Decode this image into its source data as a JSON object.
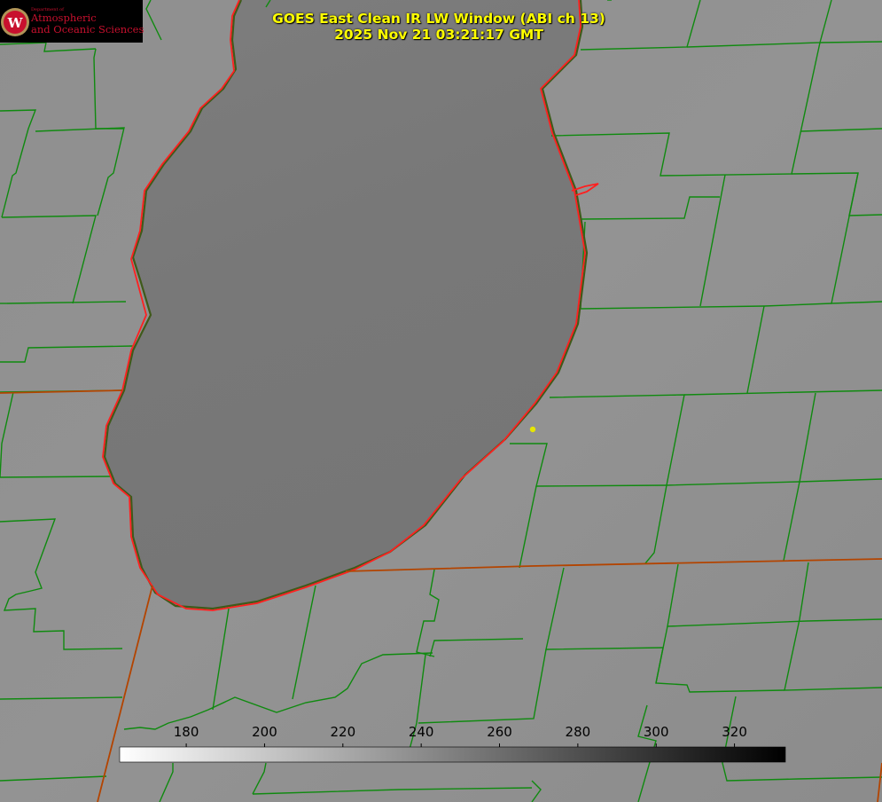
{
  "title": {
    "line1": "GOES East Clean IR LW Window (ABI ch 13)",
    "line2": "2025 Nov 21 03:21:17 GMT"
  },
  "logo": {
    "dept_small": "Department of",
    "line1": "Atmospheric",
    "line2": "and Oceanic Sciences",
    "brand_color": "#c8102e"
  },
  "colorbar": {
    "ticks": [
      "180",
      "200",
      "220",
      "240",
      "260",
      "280",
      "300",
      "320"
    ],
    "range": [
      163,
      333
    ],
    "gradient": [
      "#ffffff",
      "#000000"
    ]
  },
  "colors": {
    "county_lines": "#0f8a0f",
    "lake_shore": "#ff2020",
    "state_lines": "#b34400",
    "marker": "#e6e600",
    "title": "#ffff00"
  }
}
